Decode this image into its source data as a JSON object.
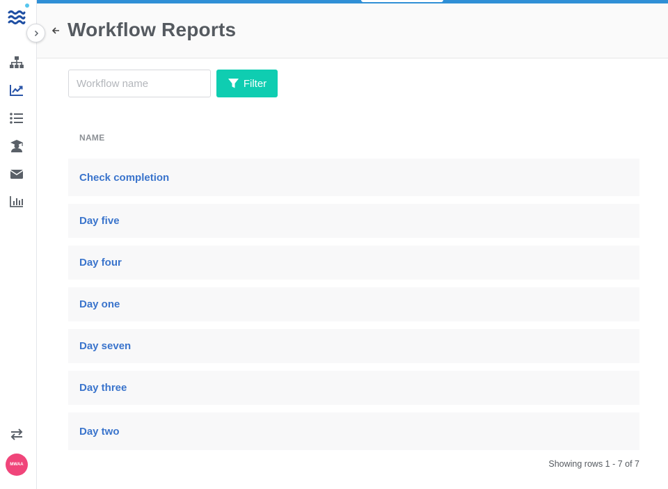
{
  "header": {
    "title": "Workflow Reports"
  },
  "filter": {
    "placeholder": "Workflow name",
    "value": "",
    "button_label": "Filter"
  },
  "table": {
    "column_header": "NAME",
    "rows": [
      "Check completion",
      "Day five",
      "Day four",
      "Day one",
      "Day seven",
      "Day three",
      "Day two"
    ]
  },
  "footer": {
    "rows_text": "Showing rows 1 - 7 of 7"
  },
  "user": {
    "avatar_initials": "MWAA"
  },
  "colors": {
    "accent": "#0fcdb1",
    "link": "#3a74cc",
    "topbar": "#2f8fd6",
    "avatar": "#f0457a",
    "nav_active": "#2a55a8"
  },
  "sidebar": {
    "items": [
      {
        "icon": "sitemap-icon",
        "active": false
      },
      {
        "icon": "line-chart-icon",
        "active": true
      },
      {
        "icon": "list-icon",
        "active": false
      },
      {
        "icon": "graduate-icon",
        "active": false
      },
      {
        "icon": "envelope-icon",
        "active": false
      },
      {
        "icon": "bar-chart-icon",
        "active": false
      }
    ],
    "bottom_icon": "swap-arrows-icon"
  }
}
